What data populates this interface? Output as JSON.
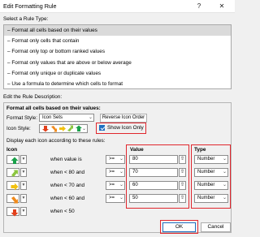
{
  "window": {
    "title": "Edit Formatting Rule",
    "help_label": "?",
    "close_label": "✕"
  },
  "rule_type": {
    "heading": "Select a Rule Type:",
    "items": [
      "– Format all cells based on their values",
      "– Format only cells that contain",
      "– Format only top or bottom ranked values",
      "– Format only values that are above or below average",
      "– Format only unique or duplicate values",
      "– Use a formula to determine which cells to format"
    ],
    "selected_index": 0
  },
  "description": {
    "heading": "Edit the Rule Description:",
    "subheading": "Format all cells based on their values:",
    "format_style_label": "Format Style:",
    "format_style_value": "Icon Sets",
    "reverse_button": "Reverse Icon Order",
    "icon_style_label": "Icon Style:",
    "show_icon_only_label": "Show Icon Only",
    "show_icon_only_checked": true,
    "display_rules_label": "Display each icon according to these rules:",
    "col_icon": "Icon",
    "col_value": "Value",
    "col_type": "Type"
  },
  "icon_rules": [
    {
      "icon": "arrow-up-icon",
      "color": "#1aa14a",
      "condition": "when value is",
      "operator": ">=",
      "value": "80",
      "type": "Number"
    },
    {
      "icon": "arrow-up-right-icon",
      "color": "#8cc63f",
      "condition": "when < 80 and",
      "operator": ">=",
      "value": "70",
      "type": "Number"
    },
    {
      "icon": "arrow-right-icon",
      "color": "#f2c10f",
      "condition": "when < 70 and",
      "operator": ">=",
      "value": "60",
      "type": "Number"
    },
    {
      "icon": "arrow-down-right-icon",
      "color": "#f08a1c",
      "condition": "when < 60 and",
      "operator": ">=",
      "value": "50",
      "type": "Number"
    },
    {
      "icon": "arrow-down-icon",
      "color": "#e2401c",
      "condition": "when < 50",
      "operator": "",
      "value": "",
      "type": ""
    }
  ],
  "icon_style_preview": [
    "#e2401c",
    "#f08a1c",
    "#f2c10f",
    "#8cc63f",
    "#1aa14a"
  ],
  "footer": {
    "ok_label": "OK",
    "cancel_label": "Cancel"
  },
  "accent_color": "#e0262d"
}
